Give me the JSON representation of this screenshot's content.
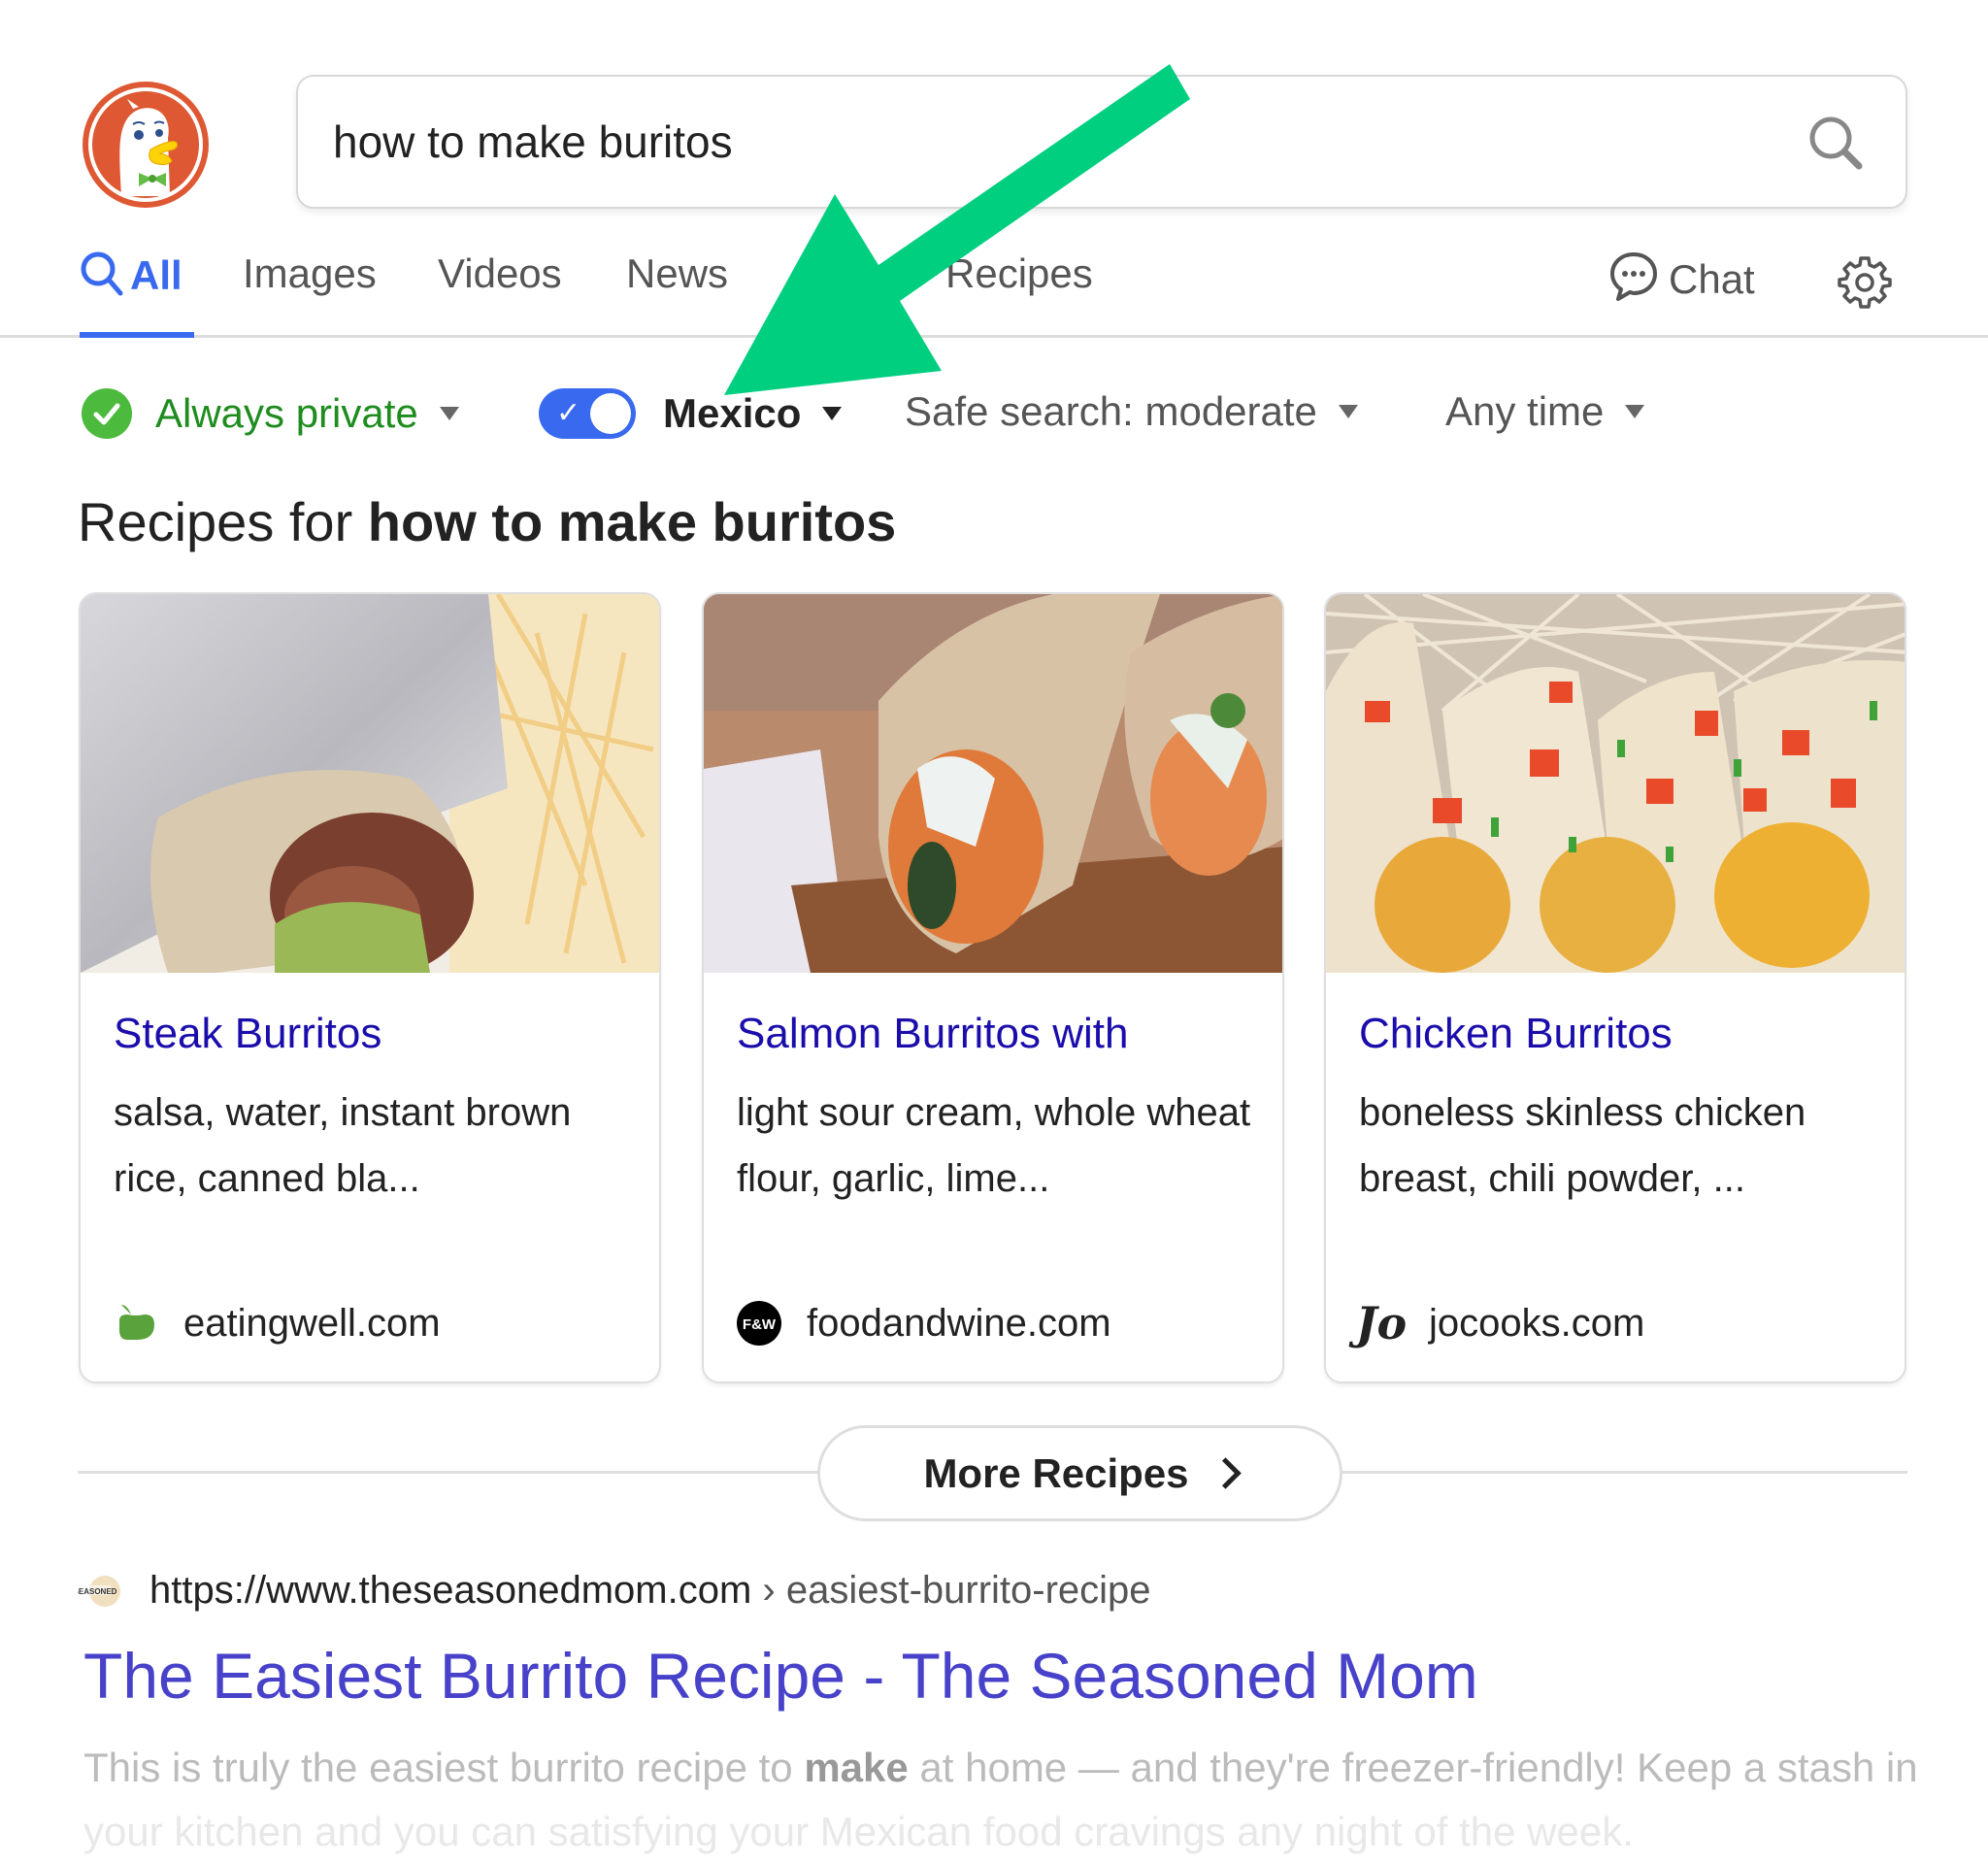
{
  "search": {
    "query": "how to make buritos",
    "submit_icon": "search-icon"
  },
  "tabs": [
    {
      "label": "All",
      "active": true,
      "icon": "search-icon"
    },
    {
      "label": "Images"
    },
    {
      "label": "Videos"
    },
    {
      "label": "News"
    },
    {
      "label": "Recipes"
    }
  ],
  "toolbar": {
    "chat_label": "Chat",
    "chat_icon": "chat-bubble-icon",
    "settings_icon": "gear-icon"
  },
  "filters": {
    "privacy_label": "Always private",
    "region_toggle_on": true,
    "region_label": "Mexico",
    "safe_search_label": "Safe search: moderate",
    "time_label": "Any time"
  },
  "recipes": {
    "heading_prefix": "Recipes for",
    "heading_query": "how to make buritos",
    "cards": [
      {
        "title": "Steak Burritos",
        "desc": "salsa, water, instant brown rice, canned bla...",
        "source": "eatingwell.com",
        "favicon": "eatingwell-apple-icon",
        "image": "steak-burrito-photo"
      },
      {
        "title": "Salmon Burritos with",
        "desc": "light sour cream, whole wheat flour, garlic, lime...",
        "source": "foodandwine.com",
        "favicon": "foodandwine-fw-icon",
        "favicon_text": "F&W",
        "image": "salmon-burrito-photo"
      },
      {
        "title": "Chicken Burritos",
        "desc": "boneless skinless chicken breast, chili powder, ...",
        "source": "jocooks.com",
        "favicon": "jocooks-jo-icon",
        "favicon_text": "Jo",
        "image": "chicken-burrito-photo"
      }
    ],
    "more_label": "More Recipes"
  },
  "result": {
    "favicon": "theseasonedmom-icon",
    "url_host": "https://www.theseasonedmom.com",
    "url_sep": " › ",
    "url_path": "easiest-burrito-recipe",
    "title": "The Easiest Burrito Recipe - The Seasoned Mom",
    "snippet_pre": "This is truly the easiest burrito recipe to ",
    "snippet_bold": "make",
    "snippet_post": " at home — and they're freezer-friendly! Keep a stash in",
    "snippet_line2": "your kitchen and you can satisfying your Mexican food cravings any night of the week."
  },
  "annotation": {
    "arrow_color": "#00cf80",
    "points_to": "region toggle"
  },
  "colors": {
    "accent": "#3969ef",
    "privacy_green": "#1e8c1e",
    "link_blue": "#1a0dab",
    "result_title": "#4742c9",
    "ddg_orange": "#de5833"
  }
}
